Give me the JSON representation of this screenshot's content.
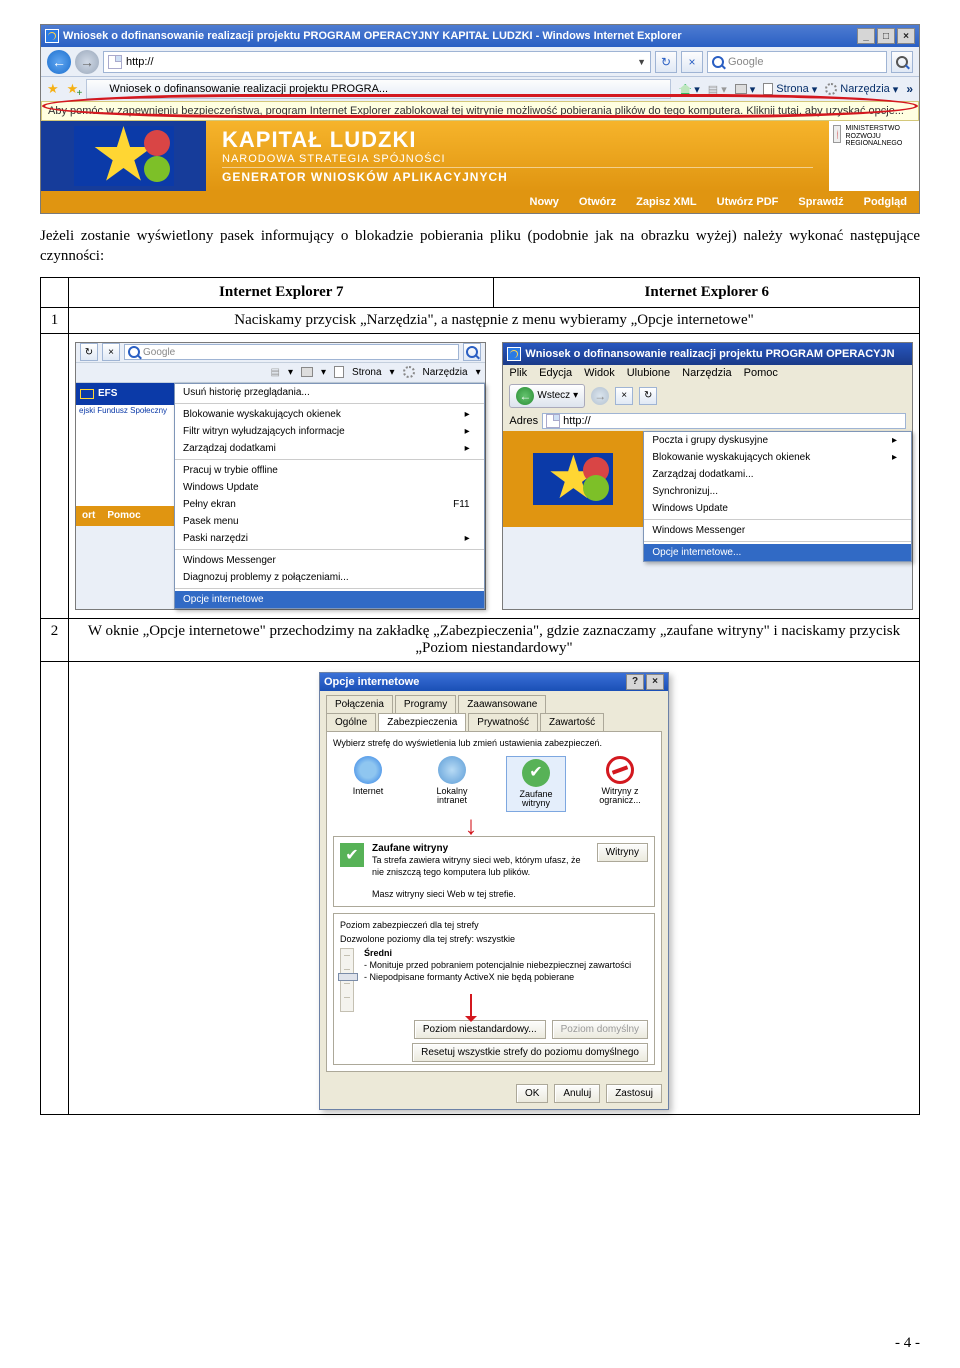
{
  "ie7_window": {
    "title": "Wniosek o dofinansowanie realizacji projektu PROGRAM OPERACYJNY KAPITAŁ LUDZKI - Windows Internet Explorer",
    "address": "http://",
    "search_placeholder": "Google",
    "tab_title": "Wniosek o dofinansowanie realizacji projektu PROGRA...",
    "tool_home": "",
    "tool_print": "",
    "tool_page": "Strona",
    "tool_tools": "Narzędzia",
    "info_bar": "Aby pomóc w zapewnieniu bezpieczeństwa, program Internet Explorer zablokował tej witrynie możliwość pobierania plików do tego komputera. Kliknij tutaj, aby uzyskać opcje..."
  },
  "site_header": {
    "title": "KAPITAŁ LUDZKI",
    "subtitle": "NARODOWA STRATEGIA SPÓJNOŚCI",
    "generator": "GENERATOR WNIOSKÓW APLIKACYJNYCH",
    "ministry": "MINISTERSTWO ROZWOJU REGIONALNEGO",
    "menu": [
      "Nowy",
      "Otwórz",
      "Zapisz XML",
      "Utwórz PDF",
      "Sprawdź",
      "Podgląd"
    ]
  },
  "doc": {
    "intro": "Jeżeli zostanie wyświetlony pasek informujący o blokadzie pobierania pliku (podobnie jak na obrazku wyżej) należy wykonać następujące czynności:",
    "col_ie7": "Internet Explorer 7",
    "col_ie6": "Internet Explorer 6",
    "step1_num": "1",
    "step1_text": "Naciskamy przycisk „Narzędzia\", a następnie z menu wybieramy „Opcje internetowe\"",
    "step2_num": "2",
    "step2_text": "W oknie „Opcje internetowe\" przechodzimy na zakładkę „Zabezpieczenia\", gdzie zaznaczamy „zaufane witryny\" i naciskamy przycisk „Poziom niestandardowy\""
  },
  "ie7_tools": {
    "search_placeholder": "Google",
    "bar_page": "Strona",
    "bar_tools": "Narzędzia",
    "efs_label": "EFS",
    "efs_sub": "ejski Fundusz Społeczny",
    "menu_ort": "ort",
    "menu_pomoc": "Pomoc",
    "items": [
      "Usuń historię przeglądania...",
      "Blokowanie wyskakujących okienek",
      "Filtr witryn wyłudzających informacje",
      "Zarządzaj dodatkami",
      "Pracuj w trybie offline",
      "Windows Update",
      "Pełny ekran",
      "Pasek menu",
      "Paski narzędzi",
      "Windows Messenger",
      "Diagnozuj problemy z połączeniami...",
      "Opcje internetowe"
    ],
    "f11": "F11"
  },
  "ie6": {
    "title": "Wniosek o dofinansowanie realizacji projektu PROGRAM OPERACYJN",
    "menus": [
      "Plik",
      "Edycja",
      "Widok",
      "Ulubione",
      "Narzędzia",
      "Pomoc"
    ],
    "back": "Wstecz",
    "addr_label": "Adres",
    "addr_value": "http://",
    "tools_items": [
      "Poczta i grupy dyskusyjne",
      "Blokowanie wyskakujących okienek",
      "Zarządzaj dodatkami...",
      "Synchronizuj...",
      "Windows Update",
      "Windows Messenger",
      "Opcje internetowe..."
    ]
  },
  "dlg": {
    "title": "Opcje internetowe",
    "tabs_row1": [
      "Połączenia",
      "Programy",
      "Zaawansowane"
    ],
    "tabs_row2": [
      "Ogólne",
      "Zabezpieczenia",
      "Prywatność",
      "Zawartość"
    ],
    "zones_instruction": "Wybierz strefę do wyświetlenia lub zmień ustawienia zabezpieczeń.",
    "zones": {
      "internet": "Internet",
      "intranet": "Lokalny intranet",
      "trusted": "Zaufane witryny",
      "restricted": "Witryny z ogranicz..."
    },
    "trusted_title": "Zaufane witryny",
    "trusted_desc": "Ta strefa zawiera witryny sieci web, którym ufasz, że nie zniszczą tego komputera lub plików.",
    "trusted_note": "Masz witryny sieci Web w tej strefie.",
    "sites_btn": "Witryny",
    "level_group": "Poziom zabezpieczeń dla tej strefy",
    "allowed": "Dozwolone poziomy dla tej strefy: wszystkie",
    "level_name": "Średni",
    "level_b1": "- Monituje przed pobraniem potencjalnie niebezpiecznej zawartości",
    "level_b2": "- Niepodpisane formanty ActiveX nie będą pobierane",
    "btn_custom": "Poziom niestandardowy...",
    "btn_default": "Poziom domyślny",
    "btn_reset": "Resetuj wszystkie strefy do poziomu domyślnego",
    "ok": "OK",
    "cancel": "Anuluj",
    "apply": "Zastosuj"
  },
  "page_number": "- 4 -"
}
